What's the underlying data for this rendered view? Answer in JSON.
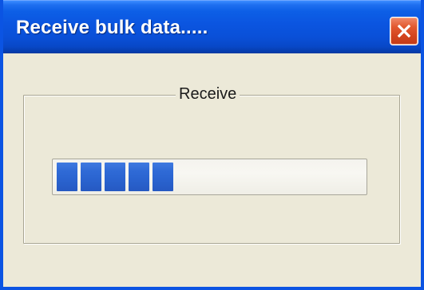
{
  "window": {
    "title": "Receive bulk data.....",
    "close_icon": "close-icon"
  },
  "group": {
    "label": "Receive"
  },
  "progress": {
    "percent": 38,
    "visible_blocks": 5
  },
  "colors": {
    "title_blue": "#0B55E0",
    "client_bg": "#ECE9D8",
    "progress_blue": "#2F6AD6",
    "close_red": "#D2431D"
  }
}
